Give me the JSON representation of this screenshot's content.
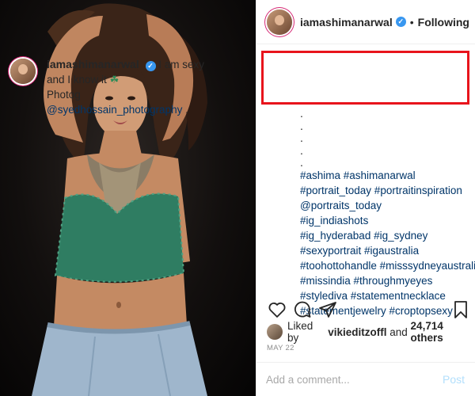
{
  "post": {
    "username": "iamashimanarwal",
    "verified_icon": "verified-badge-icon",
    "follow_separator": "•",
    "follow_status": "Following"
  },
  "caption": {
    "username": "iamashimanarwal",
    "text": "I am sexy and I know it",
    "emoji": "☘",
    "photog_label": "Photog",
    "photog_mention": "@syedhossain_photography",
    "photog_suffix": ".",
    "dots": [
      ".",
      ".",
      ".",
      ".",
      "."
    ],
    "hashtag_lines": [
      "#ashima #ashimanarwal",
      "#portrait_today #portraitinspiration",
      "@portraits_today",
      "#ig_indiashots",
      "#ig_hyderabad #ig_sydney",
      "#sexyportrait #igaustralia",
      "#toohottohandle #misssydneyaustralia",
      "#missindia #throughmyeyes",
      "#stylediva #statementnecklace",
      "#statementjewelry #croptopsexy"
    ]
  },
  "actions": {
    "like_icon": "heart-icon",
    "comment_icon": "comment-bubble-icon",
    "share_icon": "paper-plane-icon",
    "save_icon": "bookmark-icon"
  },
  "likes": {
    "prefix": "Liked by",
    "user": "vikieditzoffl",
    "middle": "and",
    "count": "24,714 others"
  },
  "date": "MAY 22",
  "comment": {
    "placeholder": "Add a comment...",
    "post_label": "Post"
  },
  "colors": {
    "highlight_border": "#e8141c",
    "link": "#003569",
    "verified": "#3897f0",
    "post_disabled": "#b2dffc"
  }
}
